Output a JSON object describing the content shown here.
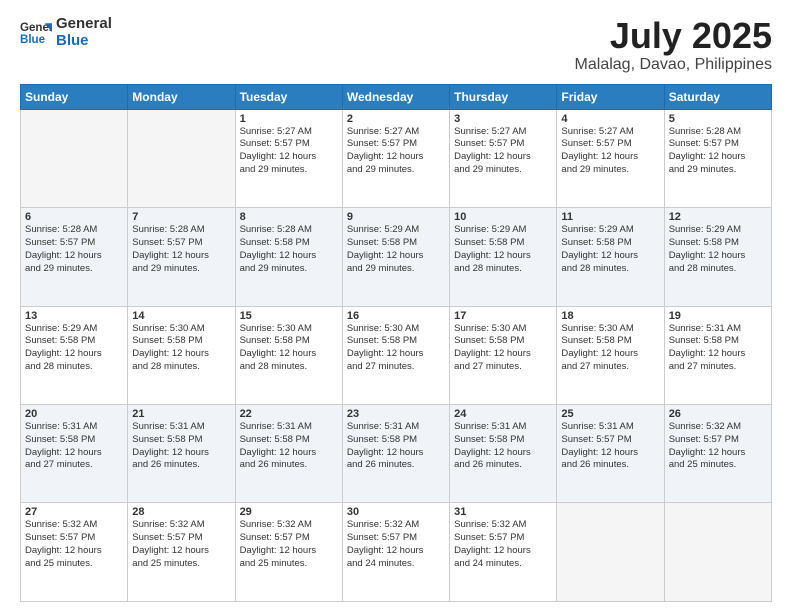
{
  "header": {
    "logo_line1": "General",
    "logo_line2": "Blue",
    "title": "July 2025",
    "subtitle": "Malalag, Davao, Philippines"
  },
  "days_of_week": [
    "Sunday",
    "Monday",
    "Tuesday",
    "Wednesday",
    "Thursday",
    "Friday",
    "Saturday"
  ],
  "weeks": [
    [
      {
        "day": "",
        "info": ""
      },
      {
        "day": "",
        "info": ""
      },
      {
        "day": "1",
        "info": "Sunrise: 5:27 AM\nSunset: 5:57 PM\nDaylight: 12 hours\nand 29 minutes."
      },
      {
        "day": "2",
        "info": "Sunrise: 5:27 AM\nSunset: 5:57 PM\nDaylight: 12 hours\nand 29 minutes."
      },
      {
        "day": "3",
        "info": "Sunrise: 5:27 AM\nSunset: 5:57 PM\nDaylight: 12 hours\nand 29 minutes."
      },
      {
        "day": "4",
        "info": "Sunrise: 5:27 AM\nSunset: 5:57 PM\nDaylight: 12 hours\nand 29 minutes."
      },
      {
        "day": "5",
        "info": "Sunrise: 5:28 AM\nSunset: 5:57 PM\nDaylight: 12 hours\nand 29 minutes."
      }
    ],
    [
      {
        "day": "6",
        "info": "Sunrise: 5:28 AM\nSunset: 5:57 PM\nDaylight: 12 hours\nand 29 minutes."
      },
      {
        "day": "7",
        "info": "Sunrise: 5:28 AM\nSunset: 5:57 PM\nDaylight: 12 hours\nand 29 minutes."
      },
      {
        "day": "8",
        "info": "Sunrise: 5:28 AM\nSunset: 5:58 PM\nDaylight: 12 hours\nand 29 minutes."
      },
      {
        "day": "9",
        "info": "Sunrise: 5:29 AM\nSunset: 5:58 PM\nDaylight: 12 hours\nand 29 minutes."
      },
      {
        "day": "10",
        "info": "Sunrise: 5:29 AM\nSunset: 5:58 PM\nDaylight: 12 hours\nand 28 minutes."
      },
      {
        "day": "11",
        "info": "Sunrise: 5:29 AM\nSunset: 5:58 PM\nDaylight: 12 hours\nand 28 minutes."
      },
      {
        "day": "12",
        "info": "Sunrise: 5:29 AM\nSunset: 5:58 PM\nDaylight: 12 hours\nand 28 minutes."
      }
    ],
    [
      {
        "day": "13",
        "info": "Sunrise: 5:29 AM\nSunset: 5:58 PM\nDaylight: 12 hours\nand 28 minutes."
      },
      {
        "day": "14",
        "info": "Sunrise: 5:30 AM\nSunset: 5:58 PM\nDaylight: 12 hours\nand 28 minutes."
      },
      {
        "day": "15",
        "info": "Sunrise: 5:30 AM\nSunset: 5:58 PM\nDaylight: 12 hours\nand 28 minutes."
      },
      {
        "day": "16",
        "info": "Sunrise: 5:30 AM\nSunset: 5:58 PM\nDaylight: 12 hours\nand 27 minutes."
      },
      {
        "day": "17",
        "info": "Sunrise: 5:30 AM\nSunset: 5:58 PM\nDaylight: 12 hours\nand 27 minutes."
      },
      {
        "day": "18",
        "info": "Sunrise: 5:30 AM\nSunset: 5:58 PM\nDaylight: 12 hours\nand 27 minutes."
      },
      {
        "day": "19",
        "info": "Sunrise: 5:31 AM\nSunset: 5:58 PM\nDaylight: 12 hours\nand 27 minutes."
      }
    ],
    [
      {
        "day": "20",
        "info": "Sunrise: 5:31 AM\nSunset: 5:58 PM\nDaylight: 12 hours\nand 27 minutes."
      },
      {
        "day": "21",
        "info": "Sunrise: 5:31 AM\nSunset: 5:58 PM\nDaylight: 12 hours\nand 26 minutes."
      },
      {
        "day": "22",
        "info": "Sunrise: 5:31 AM\nSunset: 5:58 PM\nDaylight: 12 hours\nand 26 minutes."
      },
      {
        "day": "23",
        "info": "Sunrise: 5:31 AM\nSunset: 5:58 PM\nDaylight: 12 hours\nand 26 minutes."
      },
      {
        "day": "24",
        "info": "Sunrise: 5:31 AM\nSunset: 5:58 PM\nDaylight: 12 hours\nand 26 minutes."
      },
      {
        "day": "25",
        "info": "Sunrise: 5:31 AM\nSunset: 5:57 PM\nDaylight: 12 hours\nand 26 minutes."
      },
      {
        "day": "26",
        "info": "Sunrise: 5:32 AM\nSunset: 5:57 PM\nDaylight: 12 hours\nand 25 minutes."
      }
    ],
    [
      {
        "day": "27",
        "info": "Sunrise: 5:32 AM\nSunset: 5:57 PM\nDaylight: 12 hours\nand 25 minutes."
      },
      {
        "day": "28",
        "info": "Sunrise: 5:32 AM\nSunset: 5:57 PM\nDaylight: 12 hours\nand 25 minutes."
      },
      {
        "day": "29",
        "info": "Sunrise: 5:32 AM\nSunset: 5:57 PM\nDaylight: 12 hours\nand 25 minutes."
      },
      {
        "day": "30",
        "info": "Sunrise: 5:32 AM\nSunset: 5:57 PM\nDaylight: 12 hours\nand 24 minutes."
      },
      {
        "day": "31",
        "info": "Sunrise: 5:32 AM\nSunset: 5:57 PM\nDaylight: 12 hours\nand 24 minutes."
      },
      {
        "day": "",
        "info": ""
      },
      {
        "day": "",
        "info": ""
      }
    ]
  ]
}
